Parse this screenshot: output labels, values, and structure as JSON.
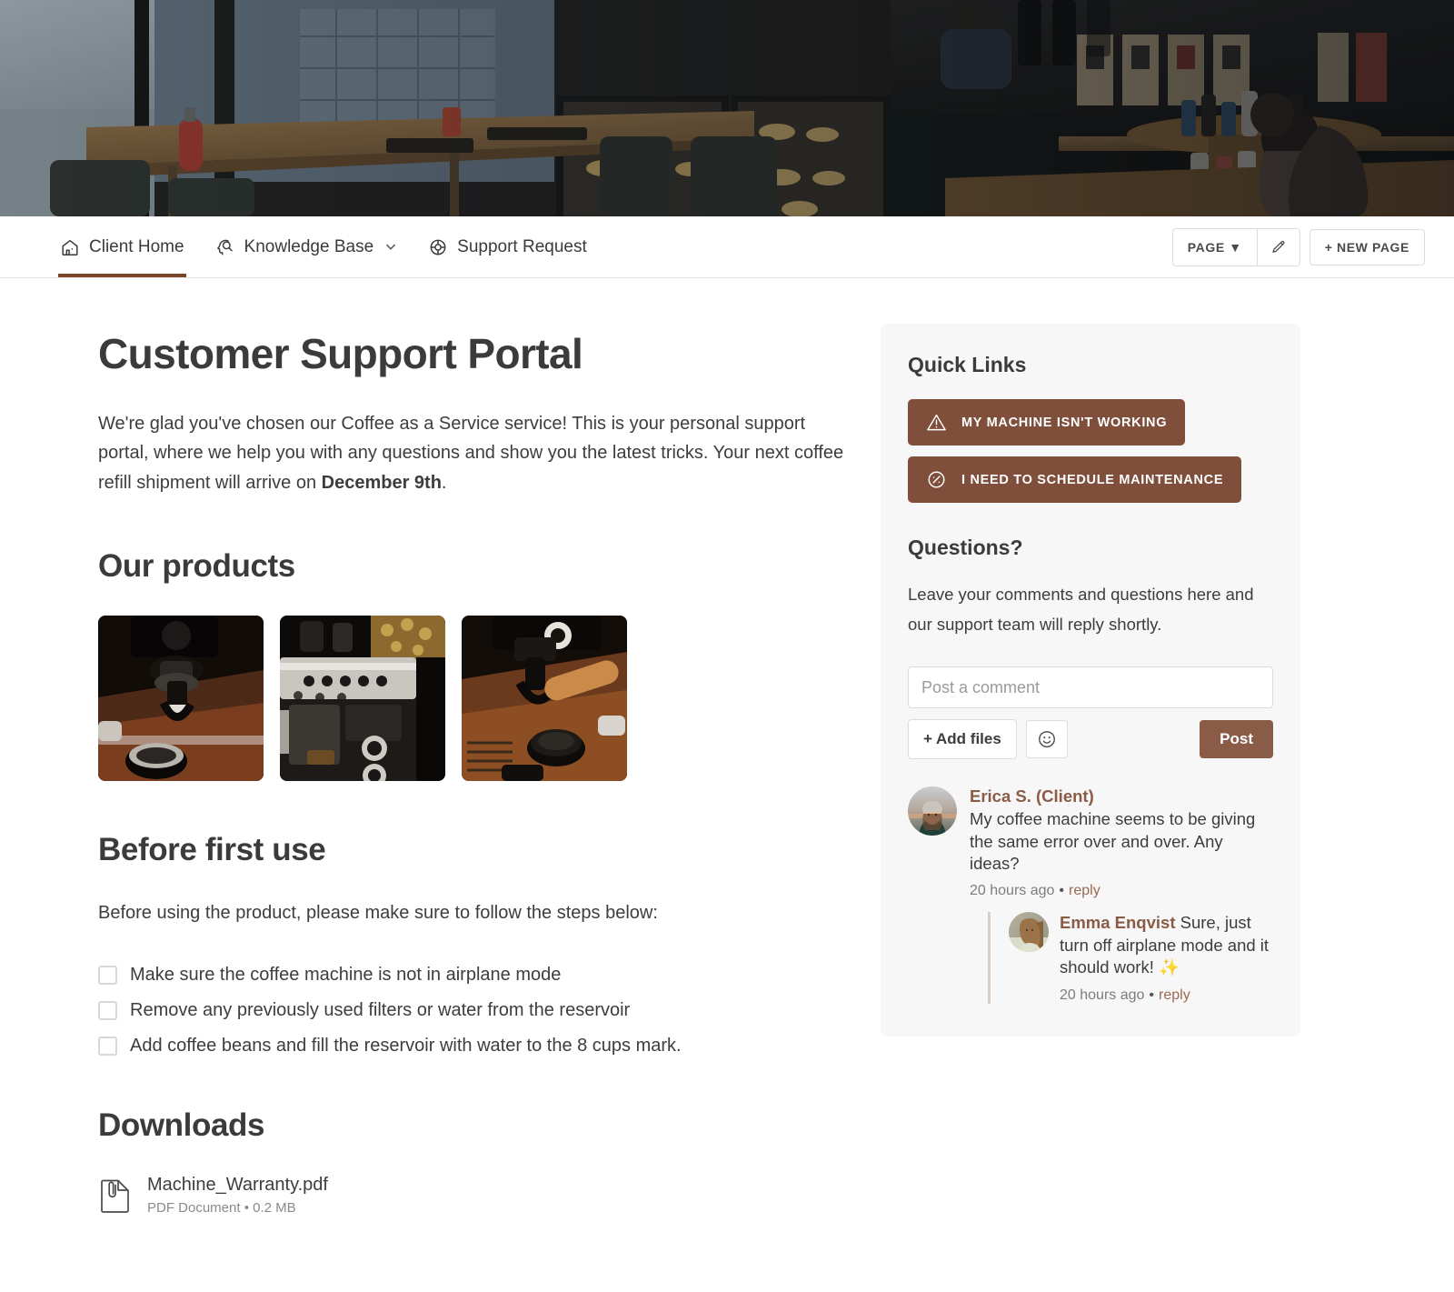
{
  "hero": {
    "alt": "coffee-shop-interior-banner"
  },
  "nav": {
    "items": [
      {
        "label": "Client Home",
        "icon": "home-icon",
        "active": true,
        "dropdown": false
      },
      {
        "label": "Knowledge Base",
        "icon": "knowledge-icon",
        "active": false,
        "dropdown": true
      },
      {
        "label": "Support Request",
        "icon": "lifebuoy-icon",
        "active": false,
        "dropdown": false
      }
    ],
    "actions": {
      "page_label": "PAGE ▼",
      "edit_icon": "pencil-icon",
      "new_page_label": "+ NEW PAGE"
    }
  },
  "main": {
    "title": "Customer Support Portal",
    "intro_part1": "We're glad you've chosen our Coffee as a Service service! This is your personal support portal, where we help you with any questions and show you the latest tricks. Your next coffee refill shipment will arrive on ",
    "intro_bold": "December 9th",
    "intro_part2": ".",
    "products_heading": "Our products",
    "products": [
      {
        "alt": "espresso-portafilter-photo"
      },
      {
        "alt": "espresso-machine-front-photo"
      },
      {
        "alt": "espresso-tamper-photo"
      }
    ],
    "before_heading": "Before first use",
    "before_lead": "Before using the product, please make sure to follow the steps below:",
    "checklist": [
      "Make sure the coffee machine is not in airplane mode",
      "Remove any previously used filters or water from the reservoir",
      "Add coffee beans and fill the reservoir with water to the 8 cups mark."
    ],
    "downloads_heading": "Downloads",
    "downloads": [
      {
        "name": "Machine_Warranty.pdf",
        "meta": "PDF Document • 0.2 MB",
        "icon": "pdf-file-icon"
      }
    ]
  },
  "sidebar": {
    "quick_links_title": "Quick Links",
    "quick_links": [
      {
        "label": "MY MACHINE ISN'T WORKING",
        "icon": "warning-triangle-icon"
      },
      {
        "label": "I NEED TO SCHEDULE MAINTENANCE",
        "icon": "gauge-icon"
      }
    ],
    "questions_title": "Questions?",
    "questions_text": "Leave your comments and questions here and our support team will reply shortly.",
    "comment_placeholder": "Post a comment",
    "comment_value": "",
    "add_files_label": "+ Add files",
    "emoji_icon": "smiley-icon",
    "post_label": "Post",
    "comments": [
      {
        "author": "Erica S. (Client)",
        "text": "My coffee machine seems to be giving the same error over and over. Any ideas?",
        "time": "20 hours ago",
        "reply_label": "reply",
        "replies": [
          {
            "author": "Emma Enqvist",
            "text": " Sure, just turn off airplane mode and it should work! ",
            "emoji": "✨",
            "time": "20 hours ago",
            "reply_label": "reply"
          }
        ]
      }
    ]
  },
  "colors": {
    "brand_brown": "#7f4f3c",
    "accent_underline": "#7d4427",
    "post_button": "#8a5c47",
    "card_bg": "#f7f7f7"
  }
}
